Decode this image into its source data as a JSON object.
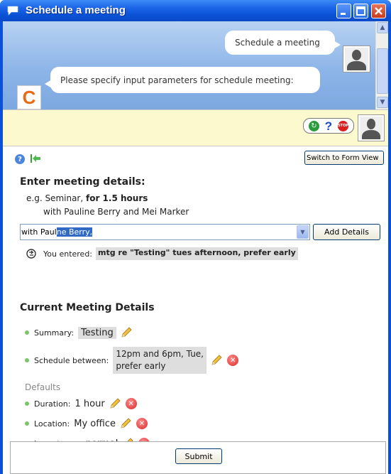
{
  "window": {
    "title": "Schedule a meeting"
  },
  "chat": {
    "user_message": "Schedule a meeting",
    "agent_message": "Please specify input parameters for schedule meeting:",
    "logo_letter": "C"
  },
  "toolbar": {
    "help_glyph": "?",
    "stop_label": "STOP"
  },
  "form": {
    "switch_button": "Switch to Form View",
    "heading": "Enter meeting details:",
    "example_prefix": "e.g. Seminar, ",
    "example_bold": "for 1.5 hours",
    "example_line2": "with Pauline Berry and Mei Marker",
    "input_typed": "with Paul",
    "input_autocomplete": "ne Berry,",
    "add_button": "Add Details",
    "entered_label": "You entered:",
    "entered_value": "mtg re \"Testing\" tues afternoon, prefer early"
  },
  "details": {
    "heading": "Current Meeting Details",
    "summary_label": "Summary:",
    "summary_value": "Testing",
    "schedule_label": "Schedule between:",
    "schedule_value": "12pm and 6pm, Tue, prefer early",
    "defaults_label": "Defaults",
    "duration_label": "Duration:",
    "duration_value": "1 hour",
    "location_label": "Location:",
    "location_value": "My office",
    "importance_label": "Importance:",
    "importance_value": "normal"
  },
  "footer": {
    "submit_button": "Submit"
  },
  "colors": {
    "title_bar": "#1a62e6",
    "toolbar_bg": "#fcf9cf",
    "selection": "#316ac5",
    "bullet": "#7cc46a",
    "delete": "#d82a2a"
  }
}
